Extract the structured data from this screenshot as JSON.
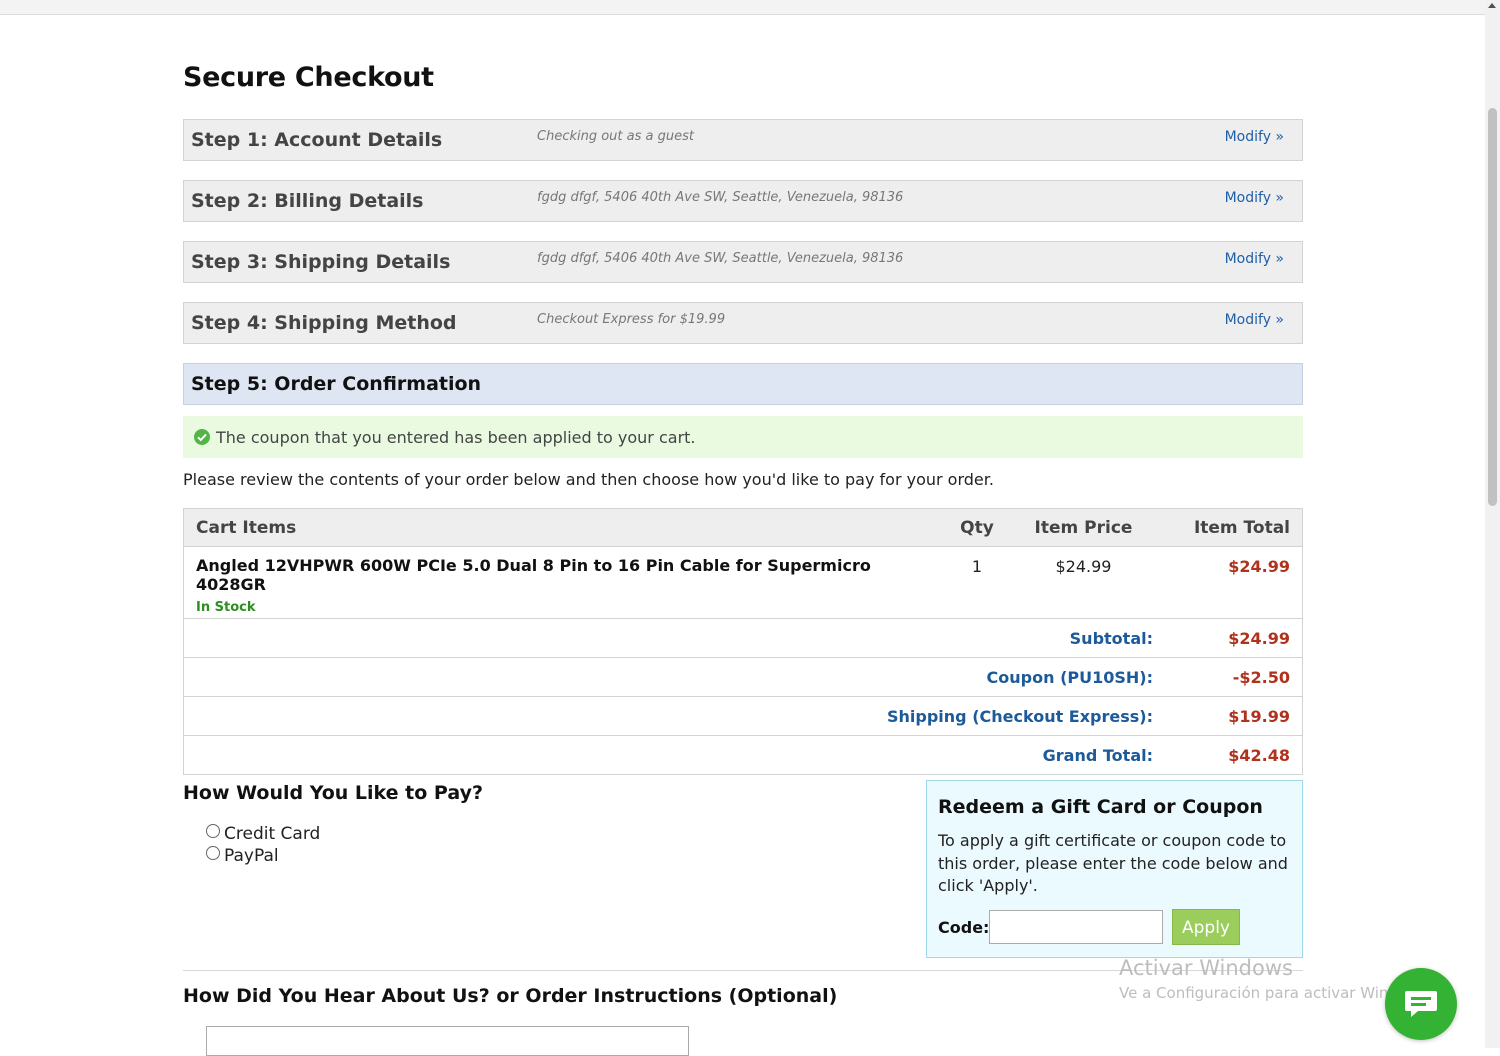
{
  "page": {
    "title": "Secure Checkout"
  },
  "steps": [
    {
      "title": "Step 1: Account Details",
      "summary": "Checking out as a guest",
      "action": "Modify »"
    },
    {
      "title": "Step 2: Billing Details",
      "summary": "fgdg dfgf, 5406 40th Ave SW, Seattle, Venezuela, 98136",
      "action": "Modify »"
    },
    {
      "title": "Step 3: Shipping Details",
      "summary": "fgdg dfgf, 5406 40th Ave SW, Seattle, Venezuela, 98136",
      "action": "Modify »"
    },
    {
      "title": "Step 4: Shipping Method",
      "summary": "Checkout Express for $19.99",
      "action": "Modify »"
    },
    {
      "title": "Step 5: Order Confirmation"
    }
  ],
  "alert": {
    "icon": "check-circle-icon",
    "text": "The coupon that you entered has been applied to your cart.",
    "color": "#55b447"
  },
  "intro": "Please review the contents of your order below and then choose how you'd like to pay for your order.",
  "cart": {
    "headers": {
      "item": "Cart Items",
      "qty": "Qty",
      "price": "Item Price",
      "total": "Item Total"
    },
    "items": [
      {
        "name": "Angled 12VHPWR 600W PCIe 5.0 Dual 8 Pin to 16 Pin Cable for Supermicro 4028GR",
        "stock": "In Stock",
        "qty": "1",
        "price": "$24.99",
        "total": "$24.99"
      }
    ],
    "summary": [
      {
        "label": "Subtotal:",
        "value": "$24.99"
      },
      {
        "label": "Coupon (PU10SH):",
        "value": "-$2.50"
      },
      {
        "label": "Shipping (Checkout Express):",
        "value": "$19.99"
      },
      {
        "label": "Grand Total:",
        "value": "$42.48"
      }
    ]
  },
  "payment": {
    "heading": "How Would You Like to Pay?",
    "options": [
      "Credit Card",
      "PayPal"
    ]
  },
  "coupon_box": {
    "title": "Redeem a Gift Card or Coupon",
    "text": "To apply a gift certificate or coupon code to this order, please enter the code below and click 'Apply'.",
    "code_label": "Code:",
    "code_value": "",
    "apply_label": "Apply"
  },
  "instructions": {
    "heading": "How Did You Hear About Us? or Order Instructions (Optional)"
  },
  "watermark": {
    "title": "Activar Windows",
    "subtitle": "Ve a Configuración para activar Windows."
  },
  "chat": {
    "icon": "chat-bubble-icon",
    "color": "#34b233"
  },
  "colors": {
    "link": "#1f5fa7",
    "price": "#b0321c",
    "summary_label": "#1d5a9a",
    "in_stock": "#2d8f1f",
    "apply_button": "#9acd5c"
  }
}
